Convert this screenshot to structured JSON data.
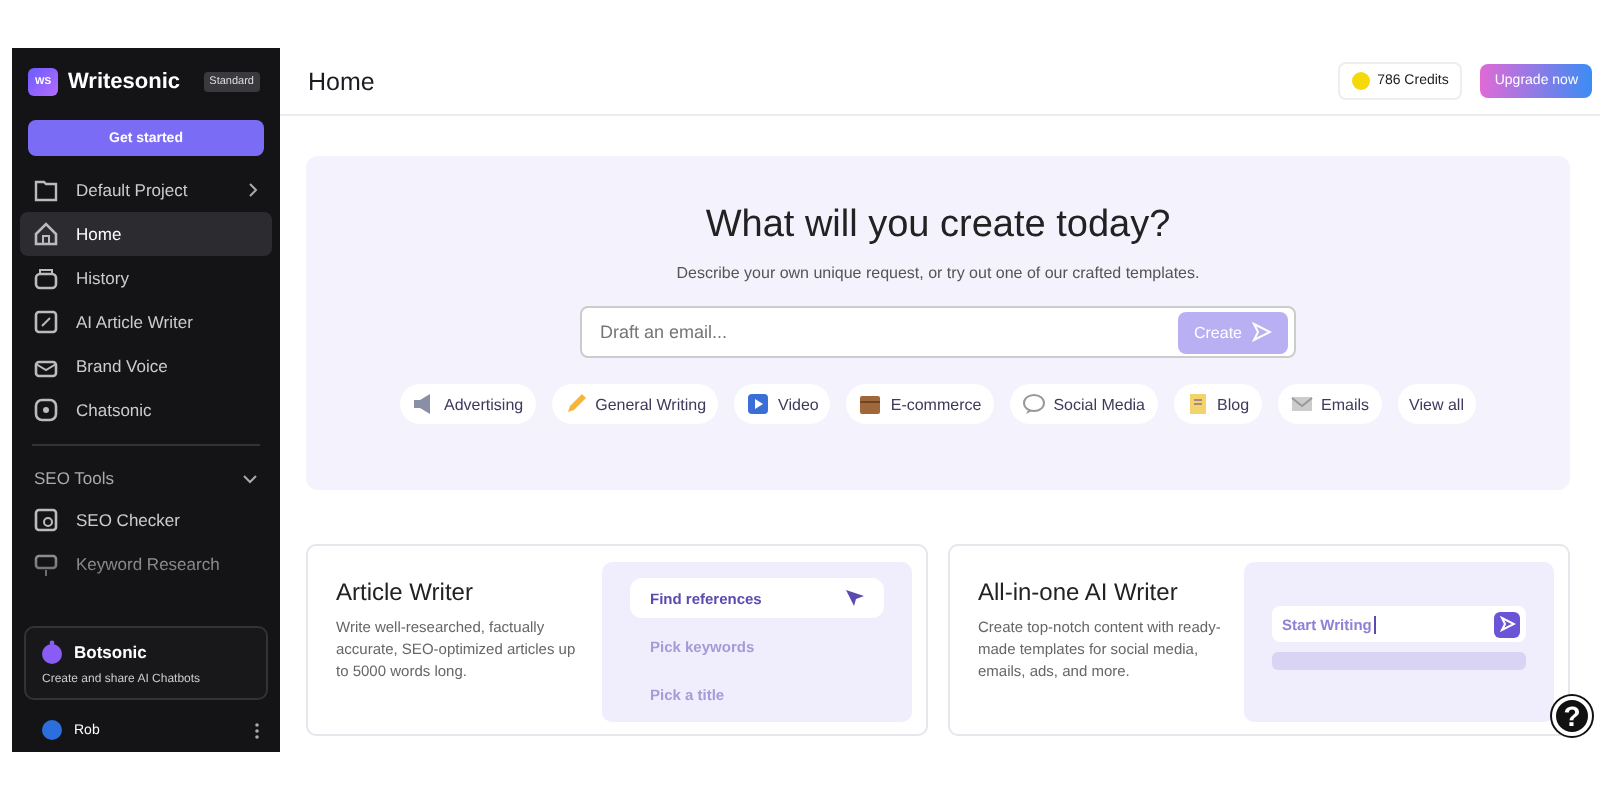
{
  "sidebar": {
    "logo_mark": "WS",
    "logo": "Writesonic",
    "plan": "Standard",
    "cta": "Get started",
    "project": "Default Project",
    "nav": [
      {
        "label": "Home",
        "kind": "home",
        "selected": true
      },
      {
        "label": "History",
        "kind": "history",
        "selected": false
      },
      {
        "label": "AI Article Writer",
        "kind": "article",
        "selected": false
      },
      {
        "label": "Brand Voice",
        "kind": "voice",
        "selected": false
      },
      {
        "label": "Chatsonic",
        "kind": "chat",
        "selected": false
      }
    ],
    "section": {
      "title": "SEO Tools",
      "expanded": true,
      "items": [
        {
          "label": "SEO Checker",
          "kind": "seo"
        },
        {
          "label": "Keyword Research",
          "kind": "keyword"
        }
      ]
    },
    "promo": {
      "title": "Botsonic",
      "text": "Create and share AI Chatbots"
    },
    "user": {
      "name": "Rob"
    }
  },
  "header": {
    "title": "Home",
    "credits": "786 Credits",
    "upgrade": "Upgrade now"
  },
  "hero": {
    "heading": "What will you create today?",
    "subtitle": "Describe your own unique request, or try out one of our crafted templates.",
    "placeholder": "Draft an email...",
    "button": "Create",
    "tags": [
      {
        "label": "Advertising",
        "kind": "megaphone"
      },
      {
        "label": "General Writing",
        "kind": "pencil"
      },
      {
        "label": "Video",
        "kind": "video"
      },
      {
        "label": "E-commerce",
        "kind": "box"
      },
      {
        "label": "Social Media",
        "kind": "chat"
      },
      {
        "label": "Blog",
        "kind": "memo"
      },
      {
        "label": "Emails",
        "kind": "mail"
      },
      {
        "label": "View all",
        "kind": "plain"
      }
    ]
  },
  "cards": [
    {
      "title": "Article Writer",
      "text": "Write well-researched, factually accurate, SEO-optimized articles up to 5000 words long.",
      "kind": "steps",
      "steps": [
        {
          "label": "Find references",
          "selected": true
        },
        {
          "label": "Pick keywords",
          "selected": false
        },
        {
          "label": "Pick a title",
          "selected": false
        }
      ]
    },
    {
      "title": "All-in-one AI Writer",
      "text": "Create top-notch content with ready-made templates for social media, emails, ads, and more.",
      "kind": "editor",
      "value": "Start Writing"
    }
  ],
  "help": "?"
}
